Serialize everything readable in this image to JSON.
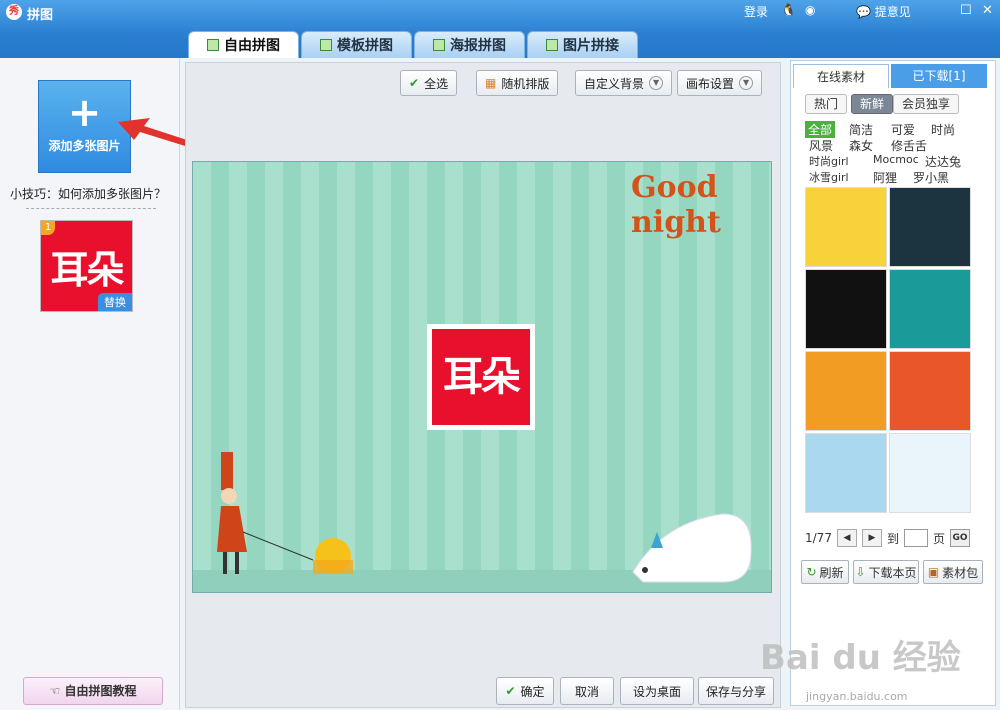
{
  "title_bar": {
    "app_title": "拼图",
    "login": "登录",
    "feedback": "提意见"
  },
  "tabs": [
    {
      "label": "自由拼图",
      "active": true
    },
    {
      "label": "模板拼图"
    },
    {
      "label": "海报拼图"
    },
    {
      "label": "图片拼接"
    }
  ],
  "left_panel": {
    "add_label": "添加多张图片",
    "tip": "小技巧：如何添加多张图片？",
    "thumb_badge": "1",
    "thumb_text": "耳朵",
    "replace_label": "替换",
    "tutorial_label": "自由拼图教程"
  },
  "toolbar": {
    "select_all": "全选",
    "random_layout": "随机排版",
    "custom_bg": "自定义背景",
    "canvas_settings": "画布设置"
  },
  "canvas": {
    "greeting": "Good night",
    "logo_text": "耳朵"
  },
  "bottom_buttons": {
    "ok": "确定",
    "cancel": "取消",
    "set_desktop": "设为桌面",
    "save_share": "保存与分享"
  },
  "right_panel": {
    "tab_online": "在线素材",
    "tab_downloaded": "已下载[1]",
    "subtabs": [
      "热门",
      "新鲜",
      "会员独享"
    ],
    "categories": [
      "全部",
      "简洁",
      "可爱",
      "时尚",
      "风景",
      "森女",
      "修舌舌",
      "时尚girl",
      "Mocmoc",
      "达达兔",
      "冰雪girl",
      "阿狸",
      "罗小黑"
    ],
    "grid_colors": [
      "#f7d23a",
      "#1c3440",
      "#111111",
      "#1b9a9a",
      "#f39c23",
      "#e8562a",
      "#a9d8ef",
      "#e9f5fb"
    ],
    "pager": {
      "page": "1/77",
      "goto": "到",
      "page_unit": "页",
      "go": "GO"
    },
    "refresh": "刷新",
    "download_page": "下载本页",
    "pack": "素材包"
  },
  "watermark": {
    "brand": "Bai du 经验",
    "url": "jingyan.baidu.com"
  }
}
